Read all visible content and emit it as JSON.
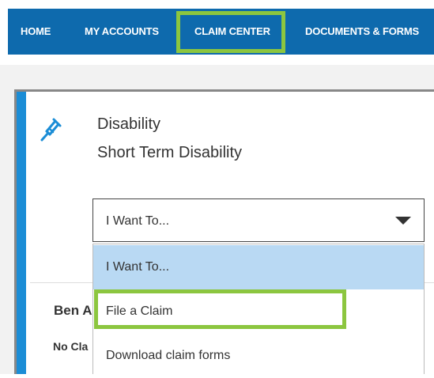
{
  "nav": {
    "items": [
      {
        "label": "HOME"
      },
      {
        "label": "MY ACCOUNTS"
      },
      {
        "label": "CLAIM CENTER"
      },
      {
        "label": "DOCUMENTS & FORMS"
      }
    ],
    "active_index": 2
  },
  "card": {
    "icon": "crutch-icon",
    "title": "Disability",
    "subtitle": "Short Term Disability",
    "select": {
      "value": "I Want To..."
    },
    "options": [
      {
        "label": "I Want To..."
      },
      {
        "label": "File a Claim"
      },
      {
        "label": "Download claim forms"
      }
    ],
    "highlighted_option_index": 0,
    "person_name_partial": "Ben A",
    "status_partial": "No Cla"
  },
  "colors": {
    "nav_bg": "#0e6aad",
    "accent_bar": "#1b8dd6",
    "highlight_outline": "#8cc63f",
    "option_hover": "#b9d9f3",
    "icon": "#1b8dd6"
  }
}
